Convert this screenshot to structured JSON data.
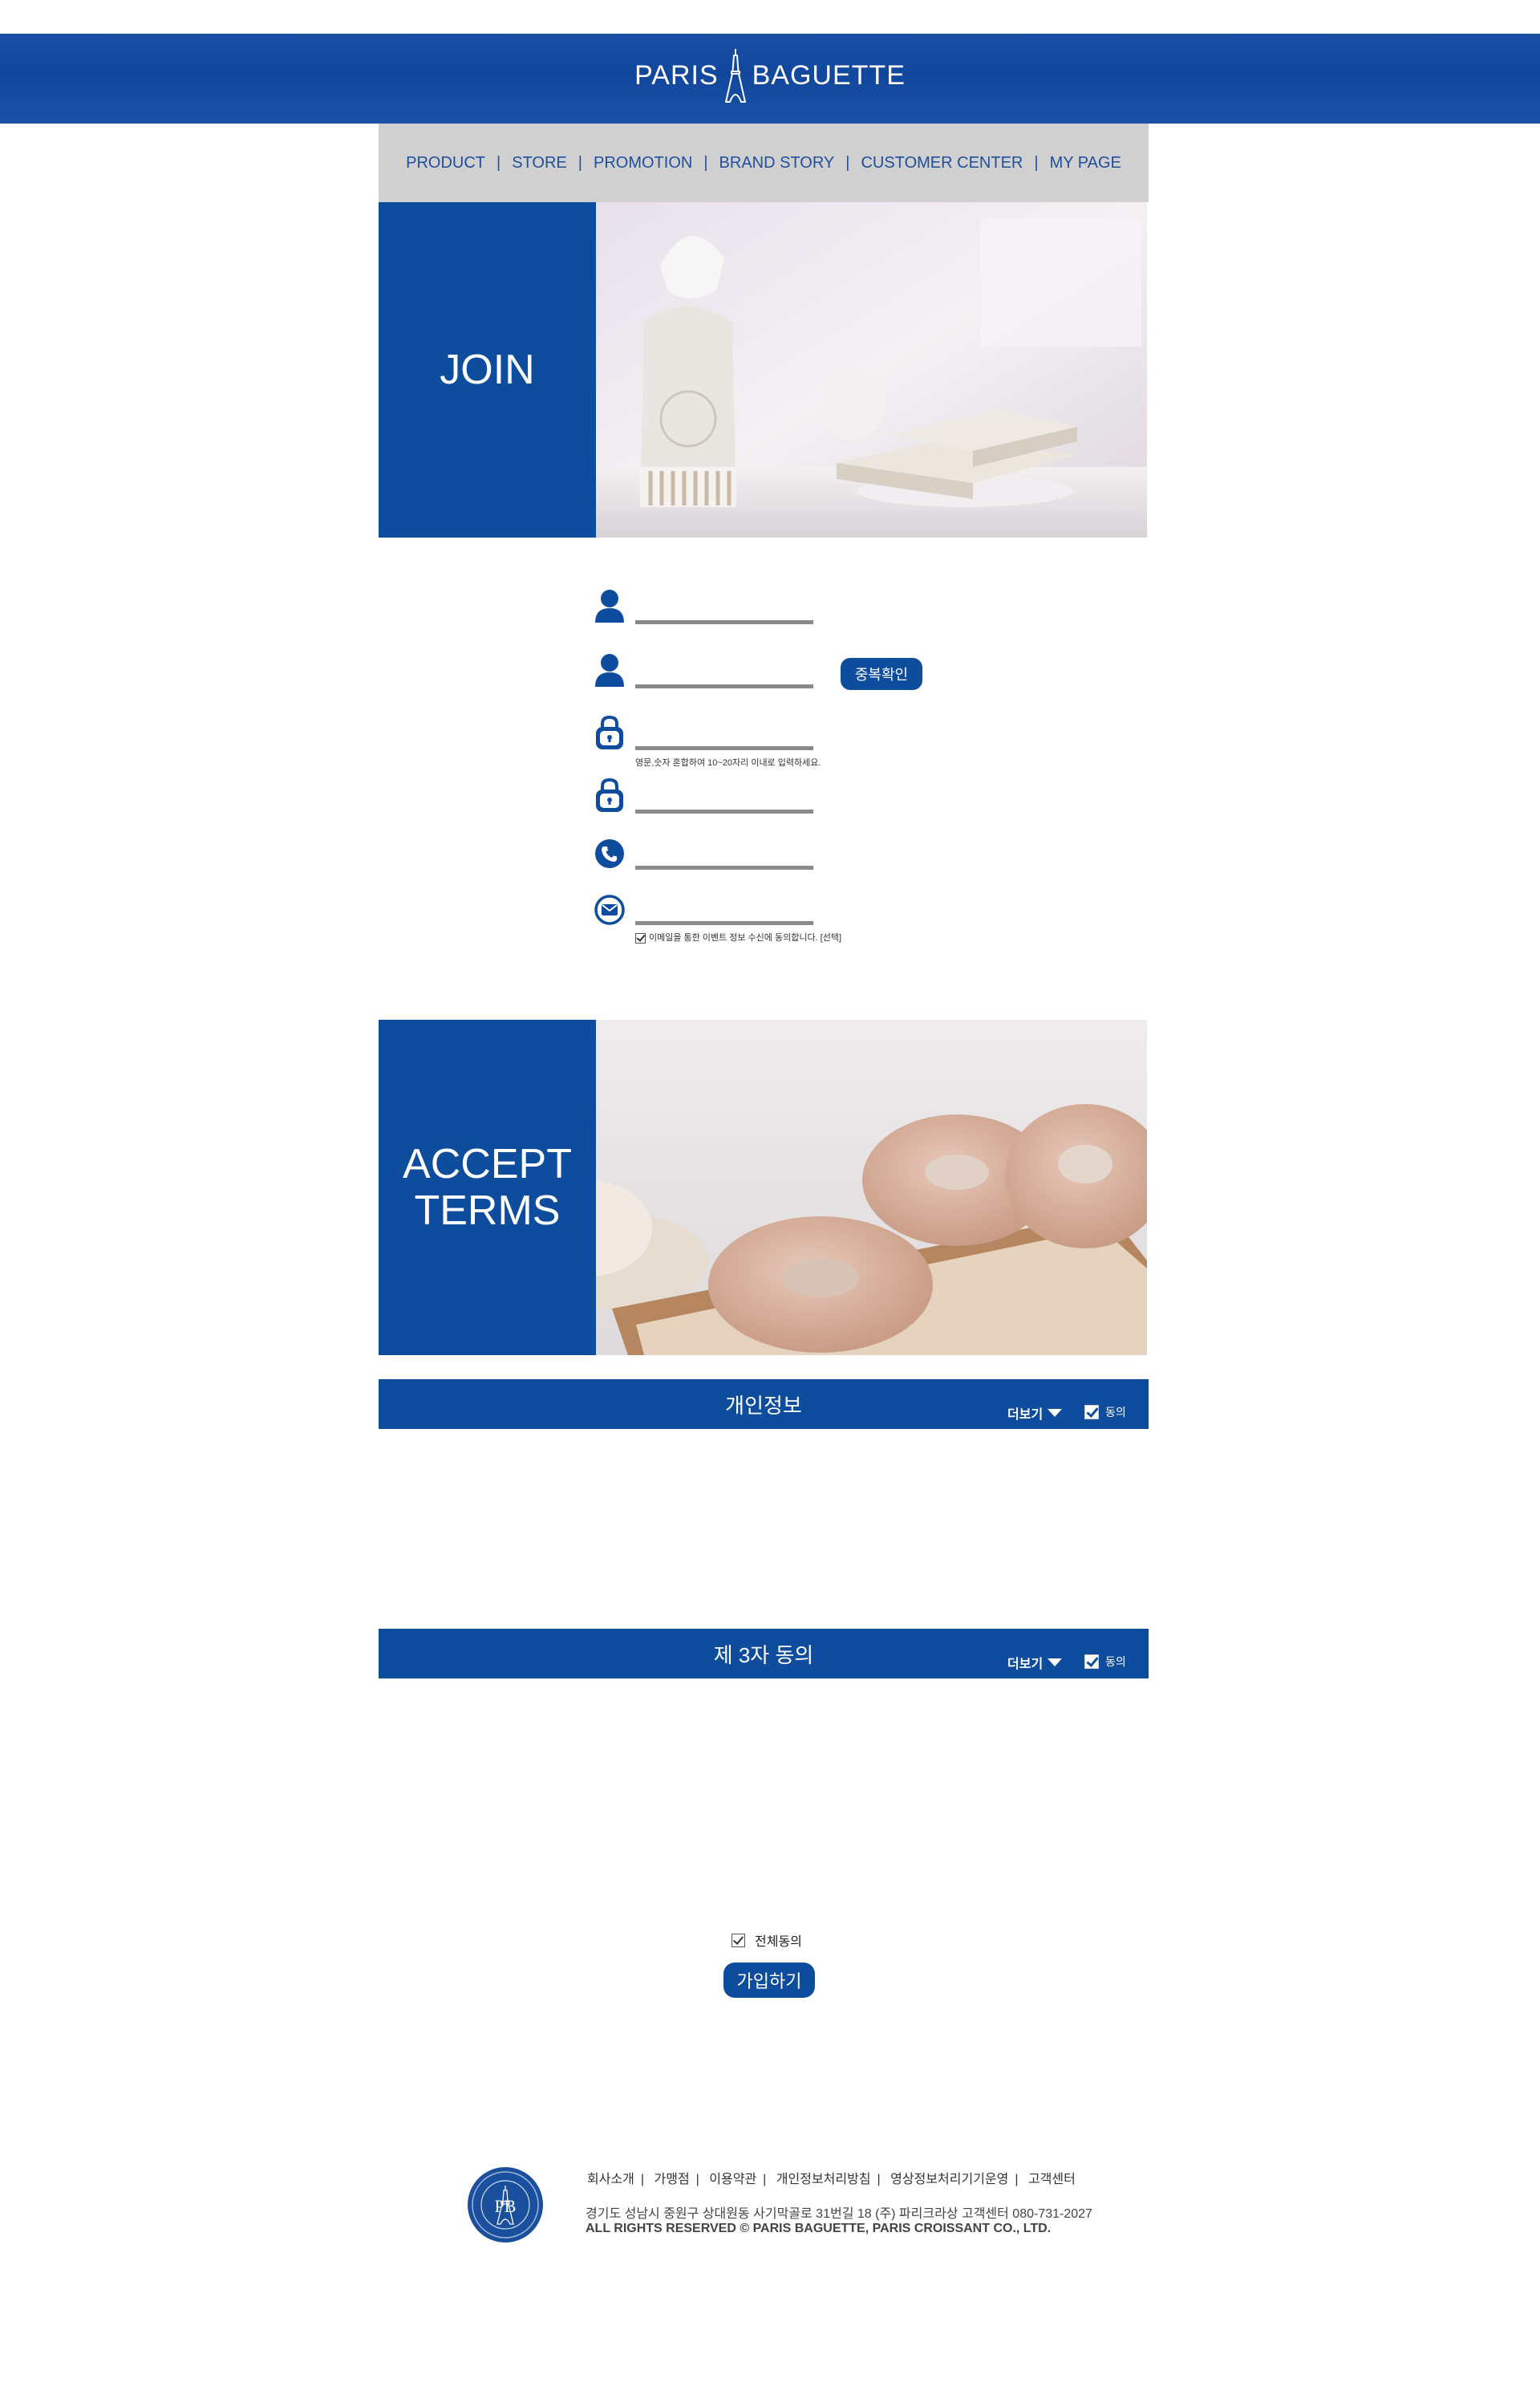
{
  "header": {
    "brand_left": "PARIS",
    "brand_right": "BAGUETTE"
  },
  "nav": {
    "items": [
      {
        "label": "PRODUCT"
      },
      {
        "label": "STORE"
      },
      {
        "label": "PROMOTION"
      },
      {
        "label": "BRAND STORY"
      },
      {
        "label": "CUSTOMER CENTER"
      },
      {
        "label": "MY PAGE"
      }
    ],
    "separator": "|"
  },
  "join": {
    "label": "JOIN"
  },
  "form": {
    "duplicate_check_label": "중복확인",
    "password_hint": "영문,숫자 혼합하여 10~20자리 이내로 입력하세요.",
    "email_consent": "이메일을 통한 이벤트 정보 수신에 동의합니다. [선택]"
  },
  "accept": {
    "label_line1": "ACCEPT",
    "label_line2": "TERMS"
  },
  "terms": [
    {
      "title": "개인정보",
      "more": "더보기",
      "agree": "동의"
    },
    {
      "title": "제 3자 동의",
      "more": "더보기",
      "agree": "동의"
    }
  ],
  "all_agree": "전체동의",
  "submit_label": "가입하기",
  "footer": {
    "links": [
      "회사소개",
      "가맹점",
      "이용약관",
      "개인정보처리방침",
      "영상정보처리기기운영",
      "고객센터"
    ],
    "address": "경기도 성남시 중원구 상대원동 사기막골로 31번길 18 (주) 파리크라상 고객센터 080-731-2027",
    "copyright": "ALL RIGHTS RESERVED © PARIS BAGUETTE, PARIS CROISSANT CO., LTD.",
    "logo_text": "PB"
  },
  "colors": {
    "brand_blue": "#0e4d9d",
    "nav_gray": "#d0d0d0",
    "input_line": "#8a8a8a"
  }
}
